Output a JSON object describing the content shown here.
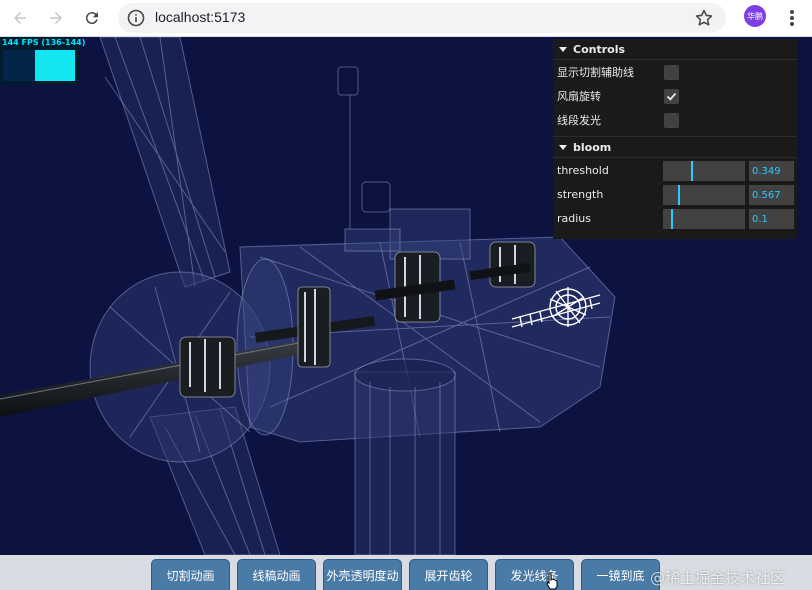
{
  "browser": {
    "url": "localhost:5173",
    "profile_label": "华鹏",
    "icons": [
      "back-arrow-icon",
      "forward-arrow-icon",
      "reload-icon",
      "info-icon",
      "star-icon",
      "kebab-menu-icon"
    ]
  },
  "stats": {
    "fps_label": "144 FPS (136-144)"
  },
  "gui": {
    "title": "Controls",
    "items": [
      {
        "label": "显示切割辅助线",
        "checked": false
      },
      {
        "label": "风扇旋转",
        "checked": true
      },
      {
        "label": "线段发光",
        "checked": false
      }
    ],
    "bloom": {
      "title": "bloom",
      "params": [
        {
          "label": "threshold",
          "value": "0.349",
          "fraction": 0.349
        },
        {
          "label": "strength",
          "value": "0.567",
          "fraction": 0.189
        },
        {
          "label": "radius",
          "value": "0.1",
          "fraction": 0.1
        }
      ]
    },
    "accent_color": "#2cc9ff"
  },
  "toolbar": {
    "buttons": [
      "切割动画",
      "线稿动画",
      "外壳透明度动",
      "展开齿轮",
      "发光线条",
      "一镜到底"
    ],
    "button_color": "#4a7aa6"
  },
  "watermark": "@稀土掘金技术社区",
  "scene": {
    "background": "#0c1340",
    "wire_color": "#ffffff"
  }
}
